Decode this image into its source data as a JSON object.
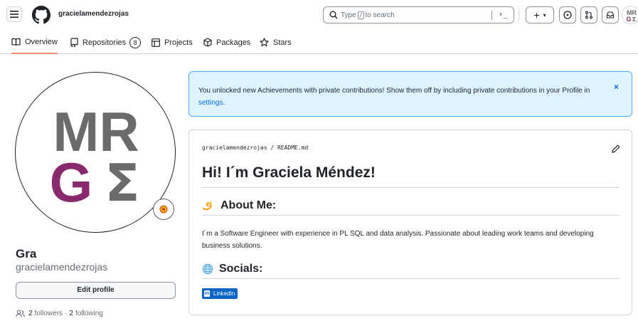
{
  "header": {
    "username": "gracielamendezrojas",
    "search": {
      "placeholder_prefix": "Type",
      "key": "/",
      "placeholder_suffix": "to search",
      "command_glyph": "›_"
    },
    "new_glyph": "+",
    "new_caret": "▾"
  },
  "tabs": [
    {
      "label": "Overview",
      "icon": "book-icon",
      "active": true
    },
    {
      "label": "Repositories",
      "icon": "repo-icon",
      "count": "8"
    },
    {
      "label": "Projects",
      "icon": "table-icon"
    },
    {
      "label": "Packages",
      "icon": "package-icon"
    },
    {
      "label": "Stars",
      "icon": "star-icon"
    }
  ],
  "avatar": {
    "line1": "MR",
    "letter_g": "G",
    "letter_sigma": "Σ",
    "colors": {
      "gray": "#6b6b6b",
      "purple": "#8a2a6e"
    }
  },
  "profile": {
    "display_name": "Gra",
    "login": "gracielamendezrojas",
    "edit_label": "Edit profile",
    "followers_count": "2",
    "followers_label": "followers",
    "dot": "·",
    "following_count": "2",
    "following_label": "following"
  },
  "flash": {
    "message": "You unlocked new Achievements with private contributions! Show them off by including private contributions in your Profile in ",
    "link": "settings",
    "end": ".",
    "close": "×"
  },
  "readme": {
    "path": "gracielamendezrojas / README.md",
    "title": "Hi! I´m Graciela Méndez!",
    "about_heading": "About Me:",
    "about_text": "I´m a Software Engineer with experience in PL SQL and data analysis. Passionate about leading work teams and developing business solutions.",
    "socials_heading": "Socials:",
    "badge_label": "LinkedIn",
    "badge_logo": "in"
  },
  "colors": {
    "accent_tab": "#fd8c73",
    "link": "#0969da",
    "flash_bg": "#ddf4ff",
    "flash_border": "#54aeff",
    "linkedin": "#0a66c2"
  }
}
